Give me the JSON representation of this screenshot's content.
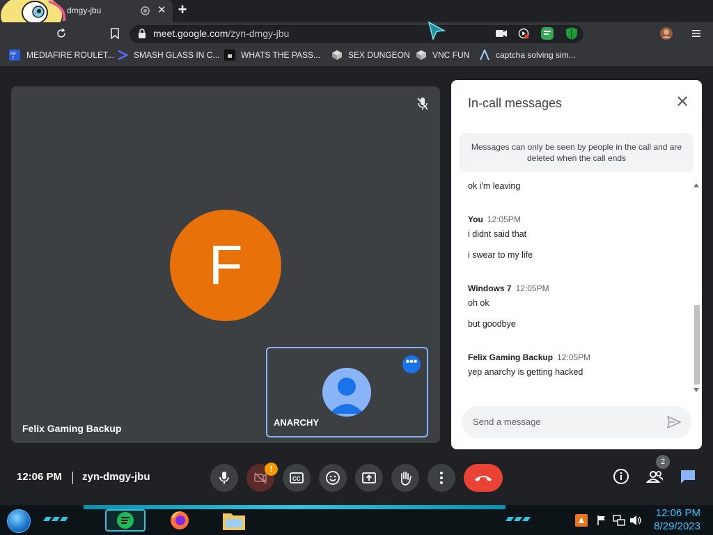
{
  "browser": {
    "tab_title": "dmgy-jbu",
    "url_host": "meet.google.com",
    "url_path": "/zyn-dmgy-jbu",
    "bookmarks": [
      {
        "label": "MEDIAFIRE ROULET..."
      },
      {
        "label": "SMASH GLASS IN C..."
      },
      {
        "label": "WHATS THE PASS..."
      },
      {
        "label": "SEX DUNGEON"
      },
      {
        "label": "VNC FUN"
      },
      {
        "label": "captcha solving sim..."
      }
    ]
  },
  "stage": {
    "main_avatar_letter": "F",
    "main_participant": "Felix Gaming Backup",
    "self_participant": "ANARCHY",
    "colors": {
      "main_avatar": "#e8710a",
      "self_avatar": "#8ab4f8",
      "tile_border": "#8ab4f8"
    }
  },
  "chat": {
    "title": "In-call messages",
    "notice": "Messages can only be seen by people in the call and are deleted when the call ends",
    "messages": [
      {
        "text": "ok i'm leaving"
      },
      {
        "sender": "You",
        "time": "12:05PM",
        "lines": [
          "i didnt said that",
          "i swear to my life"
        ]
      },
      {
        "sender": "Windows 7",
        "time": "12:05PM",
        "lines": [
          "oh ok",
          "but goodbye"
        ]
      },
      {
        "sender": "Felix Gaming Backup",
        "time": "12:05PM",
        "lines": [
          "yep anarchy is getting hacked"
        ]
      }
    ],
    "compose_placeholder": "Send a message"
  },
  "bottom_bar": {
    "time": "12:06 PM",
    "meeting_code": "zyn-dmgy-jbu",
    "camera_warning": "!",
    "people_count": "2",
    "end_call_color": "#ea4335"
  },
  "taskbar": {
    "time": "12:06 PM",
    "date": "8/29/2023"
  }
}
